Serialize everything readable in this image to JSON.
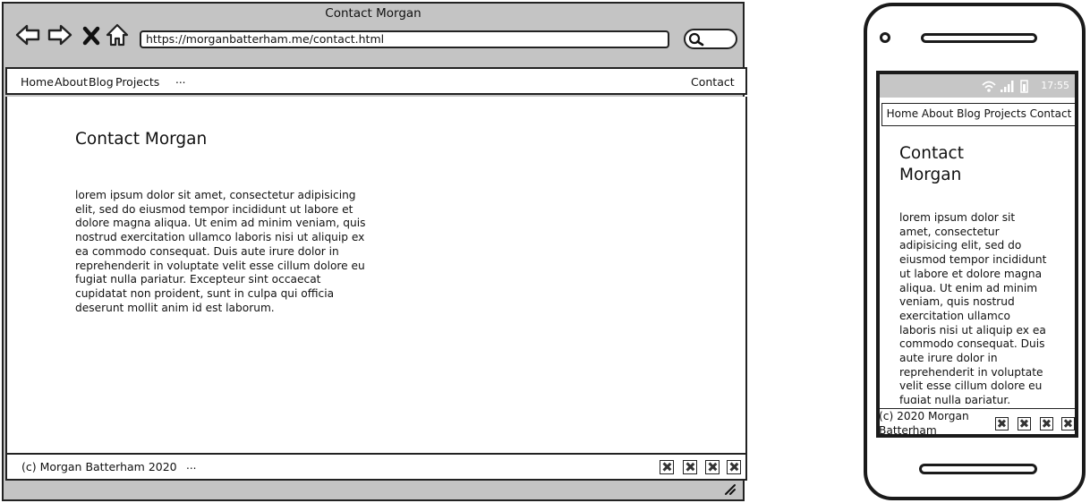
{
  "desktop": {
    "window_title": "Contact Morgan",
    "toolbar": {
      "back_icon": "arrow-left-icon",
      "forward_icon": "arrow-right-icon",
      "stop_icon": "close-icon",
      "home_icon": "home-icon"
    },
    "url": "https://morganbatterham.me/contact.html",
    "search_icon": "search-icon",
    "nav": {
      "items": [
        "Home",
        "About",
        "Blog",
        "Projects"
      ],
      "more": "...",
      "contact": "Contact"
    },
    "page_title": "Contact Morgan",
    "body_text": "lorem ipsum dolor sit amet, consectetur adipisicing elit, sed do eiusmod tempor incididunt ut labore et dolore magna aliqua. Ut enim ad minim veniam, quis nostrud exercitation ullamco laboris nisi ut aliquip ex ea commodo consequat. Duis aute irure dolor in reprehenderit in voluptate velit esse cillum dolore eu fugiat nulla pariatur. Excepteur sint occaecat cupidatat non proident, sunt in culpa qui officia deserunt mollit anim id est laborum.",
    "footer": {
      "text": "(c) Morgan Batterham 2020",
      "more": "...",
      "social_icons": [
        "social-link-icon",
        "social-link-icon",
        "social-link-icon",
        "social-link-icon"
      ]
    }
  },
  "mobile": {
    "status_time": "17:55",
    "status_icons": [
      "wifi-icon",
      "signal-icon",
      "battery-icon"
    ],
    "nav_text": "Home About Blog Projects Contact",
    "page_title": "Contact Morgan",
    "body_text": "lorem ipsum dolor sit amet, consectetur adipisicing elit, sed do eiusmod tempor incididunt ut labore et dolore magna aliqua. Ut enim ad minim veniam, quis nostrud exercitation ullamco laboris nisi ut aliquip ex ea commodo consequat. Duis aute irure dolor in reprehenderit in voluptate velit esse cillum dolore eu fugiat nulla pariatur. Excepteur sint",
    "footer_text": "(c) 2020 Morgan Batterham",
    "social_icons": [
      "social-link-icon",
      "social-link-icon",
      "social-link-icon",
      "social-link-icon"
    ]
  },
  "colors": {
    "chrome_gray": "#c4c4c4",
    "status_bar_gray": "#c6c6c6",
    "stroke": "#222222"
  }
}
